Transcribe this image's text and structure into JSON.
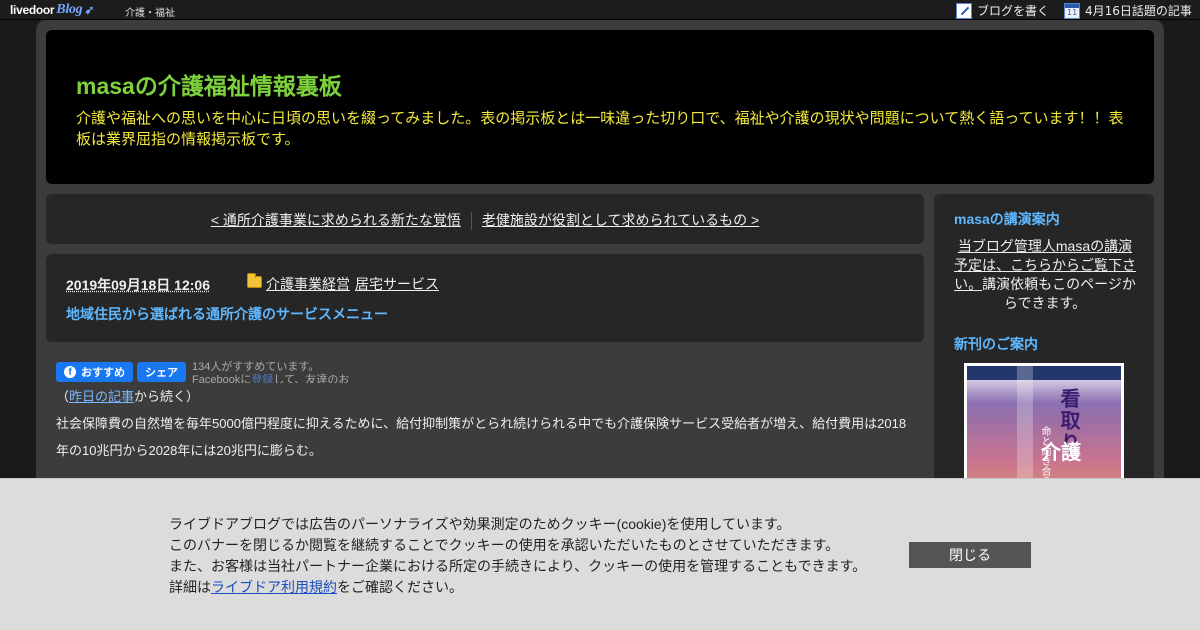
{
  "topbar": {
    "logo_main": "livedoor",
    "logo_sub": "Blog",
    "category": "介護・福祉",
    "write_blog": "ブログを書く",
    "calendar_day": "11",
    "trending": "4月16日話題の記事"
  },
  "header": {
    "title": "masaの介護福祉情報裏板",
    "description": "介護や福祉への思いを中心に日頃の思いを綴ってみました。表の掲示板とは一味違った切り口で、福祉や介護の現状や問題について熱く語っています！！表板は業界屈指の情報掲示板です。"
  },
  "nav": {
    "prev": "< 通所介護事業に求められる新たな覚悟",
    "next": "老健施設が役割として求められているもの >"
  },
  "article": {
    "date": "2019年09月18日 12:06",
    "categories": [
      "介護事業経営",
      "居宅サービス"
    ],
    "title": "地域住民から選ばれる通所介護のサービスメニュー",
    "fb_recommend": "おすすめ",
    "fb_share": "シェア",
    "fb_count": "134人がすすめています。",
    "fb_signup_pre": "Facebookに",
    "fb_signup_link": "登録",
    "fb_signup_post": "して、友達のお",
    "continued_open": "（",
    "continued_link": "昨日の記事",
    "continued_close": "から続く）",
    "paragraph1": "社会保障費の自然増を毎年5000億円程度に抑えるために、給付抑制策がとられ続けられる中でも介護保険サービス受給者が増え、給付費用は2018年の10兆円から2028年には20兆円に膨らむ。"
  },
  "sidebar": {
    "lecture_heading": "masaの講演案内",
    "lecture_link": "当ブログ管理人masaの講演予定は、こちらからご覧下さい。",
    "lecture_text": "講演依頼もこのページからできます。",
    "books_heading": "新刊のご案内",
    "book_title": "看取り",
    "book_sub": "命と向き合う",
    "book_word": "介護"
  },
  "cookie": {
    "line1": "ライブドアブログでは広告のパーソナライズや効果測定のためクッキー(cookie)を使用しています。",
    "line2": "このバナーを閉じるか閲覧を継続することでクッキーの使用を承認いただいたものとさせていただきます。",
    "line3": "また、お客様は当社パートナー企業における所定の手続きにより、クッキーの使用を管理することもできます。",
    "line4_pre": "詳細は",
    "line4_link": "ライブドア利用規約",
    "line4_post": "をご確認ください。",
    "close": "閉じる"
  }
}
